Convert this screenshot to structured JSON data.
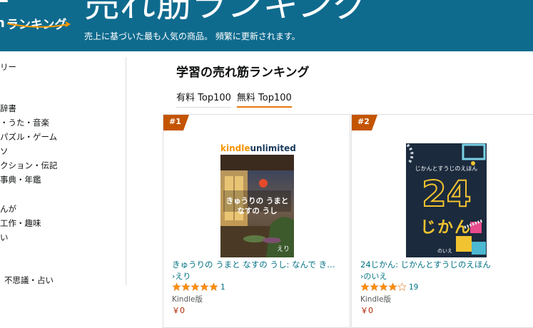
{
  "header": {
    "brand": "ランキング",
    "title": "売れ筋ランキング",
    "subtitle": "売上に基づいた最も人気の商品。 頻繁に更新されます。",
    "colors": {
      "banner": "#0f6b8e",
      "accent": "#e47911"
    }
  },
  "sidebar": {
    "items": [
      {
        "label": "リー"
      },
      {
        "label": "辞書"
      },
      {
        "label": "・うた・音楽"
      },
      {
        "label": "パズル・ゲーム"
      },
      {
        "label": "ソ"
      },
      {
        "label": "クション・伝記"
      },
      {
        "label": "事典・年鑑"
      },
      {
        "label": "んが"
      },
      {
        "label": "工作・趣味"
      },
      {
        "label": "い"
      },
      {
        "label": "不思議・占い"
      }
    ]
  },
  "main": {
    "title": "学習の売れ筋ランキング",
    "tabs": [
      {
        "label": "有料 Top100",
        "active": false
      },
      {
        "label": "無料 Top100",
        "active": true
      }
    ]
  },
  "products": [
    {
      "rank": "#1",
      "cover_brand": "kindleunlimited",
      "cover_title_line1": "きゅうりの うまと",
      "cover_title_line2": "なすの うし",
      "cover_author": "えり",
      "title": "きゅうりの うまと なすの うし: なんで きゅうりと なすで",
      "author": "えり",
      "rating": 5,
      "review_count": "1",
      "format": "Kindle版",
      "price": "￥0"
    },
    {
      "rank": "#2",
      "cover_title": "じかんとすうじのえほん",
      "cover_big": "24",
      "cover_sub": "じかん",
      "cover_author": "のいえ",
      "title": "24じかん: じかんとすうじのえほん",
      "author": "のいえ",
      "rating": 4,
      "review_count": "19",
      "format": "Kindle版",
      "price": "￥0"
    }
  ]
}
